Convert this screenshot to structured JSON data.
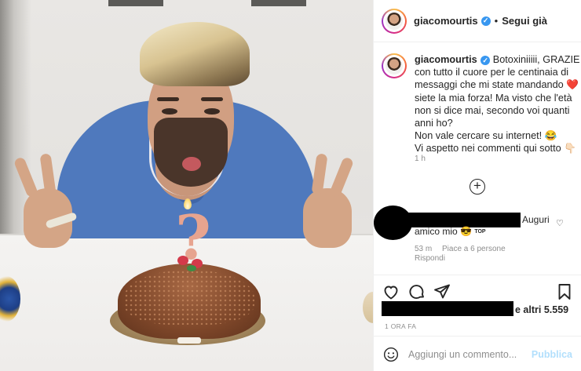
{
  "post": {
    "author": "giacomourtis",
    "verified_badge": "verified-check-icon",
    "separator": "•",
    "follow_status": "Segui già"
  },
  "caption": {
    "author": "giacomourtis",
    "lines": [
      "Botoxiniiiii, GRAZIE",
      "con tutto il cuore per le centinaia di",
      "messaggi che mi state mandando ❤️",
      "siete la mia forza! Ma visto che l'età",
      "non si dice mai, secondo voi quanti",
      "anni ho?",
      "Non vale cercare su internet! 😂",
      "Vi aspetto nei commenti qui sotto 👇🏻"
    ],
    "time": "1 h"
  },
  "comment": {
    "text_part1": "Auguri",
    "text_part2": "amico mio 😎",
    "top_badge": "TOP",
    "time": "53 m",
    "likes": "Piace a 6 persone",
    "reply": "Rispondi"
  },
  "likes": {
    "text": "e altri 5.559"
  },
  "timestamp": "1 ORA FA",
  "comment_box": {
    "placeholder": "Aggiungi un commento...",
    "publish": "Pubblica"
  },
  "photo": {
    "candle_glyph": "?"
  },
  "colors": {
    "verified": "#3897f0",
    "publish_disabled": "#b2dffc",
    "muted": "#8e8e8e"
  }
}
